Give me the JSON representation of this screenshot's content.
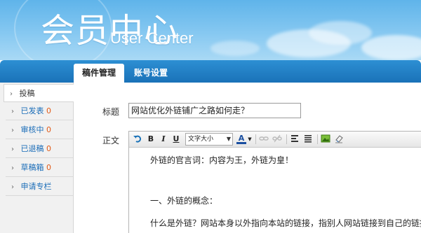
{
  "header": {
    "title_cn": "会员中心",
    "title_en": "User Center"
  },
  "nav": {
    "tabs": [
      {
        "label": "稿件管理"
      },
      {
        "label": "账号设置"
      }
    ]
  },
  "sidebar": {
    "items": [
      {
        "label": "投稿",
        "count": ""
      },
      {
        "label": "已发表",
        "count": "0"
      },
      {
        "label": "审核中",
        "count": "0"
      },
      {
        "label": "已退稿",
        "count": "0"
      },
      {
        "label": "草稿箱",
        "count": "0"
      },
      {
        "label": "申请专栏",
        "count": ""
      }
    ]
  },
  "form": {
    "title_label": "标题",
    "title_value": "网站优化外链铺广之路如何走？",
    "body_label": "正文"
  },
  "editor": {
    "toolbar": {
      "undo_icon": "undo-icon",
      "bold": "B",
      "italic": "I",
      "underline": "U",
      "font_size": "文字大小",
      "font_color": "A",
      "accent_color": "#1a72b8"
    },
    "content": [
      "外链的官言词：内容为王，外链为皇！",
      "",
      "一、外链的概念：",
      "什么是外链？网站本身以外指向本站的链接，指别人网站链接到自己的链接；"
    ]
  }
}
